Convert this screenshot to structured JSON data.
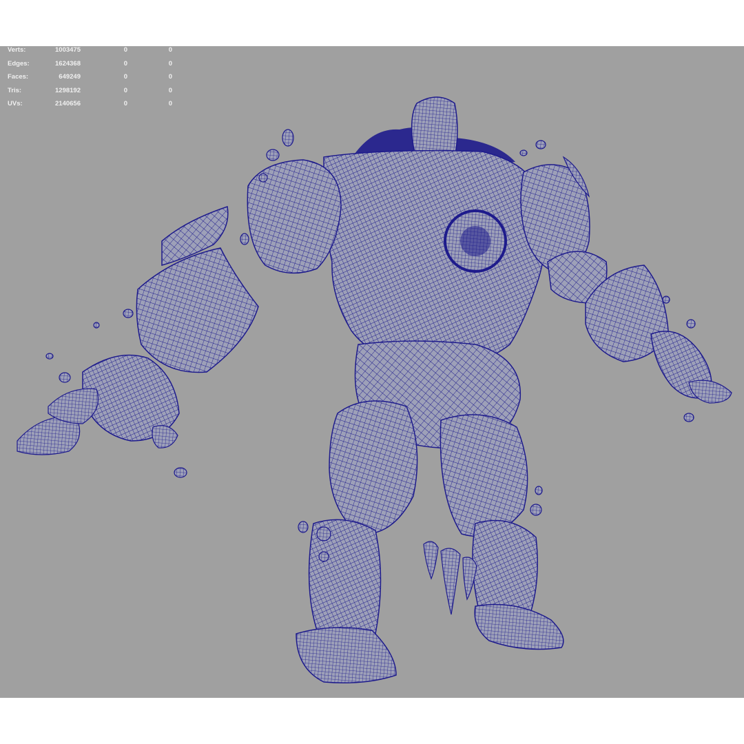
{
  "viewport": {
    "background_color": "#a0a0a0",
    "wire_color": "#1e1b8c",
    "shade_color": "#9da0b8",
    "heads_up_display": {
      "poly_count": [
        {
          "label": "Verts:",
          "total": "1003475",
          "selected": "0",
          "component": "0"
        },
        {
          "label": "Edges:",
          "total": "1624368",
          "selected": "0",
          "component": "0"
        },
        {
          "label": "Faces:",
          "total": "649249",
          "selected": "0",
          "component": "0"
        },
        {
          "label": "Tris:",
          "total": "1298192",
          "selected": "0",
          "component": "0"
        },
        {
          "label": "UVs:",
          "total": "2140656",
          "selected": "0",
          "component": "0"
        }
      ]
    },
    "model": {
      "display_mode": "wireframe-on-shaded"
    }
  }
}
